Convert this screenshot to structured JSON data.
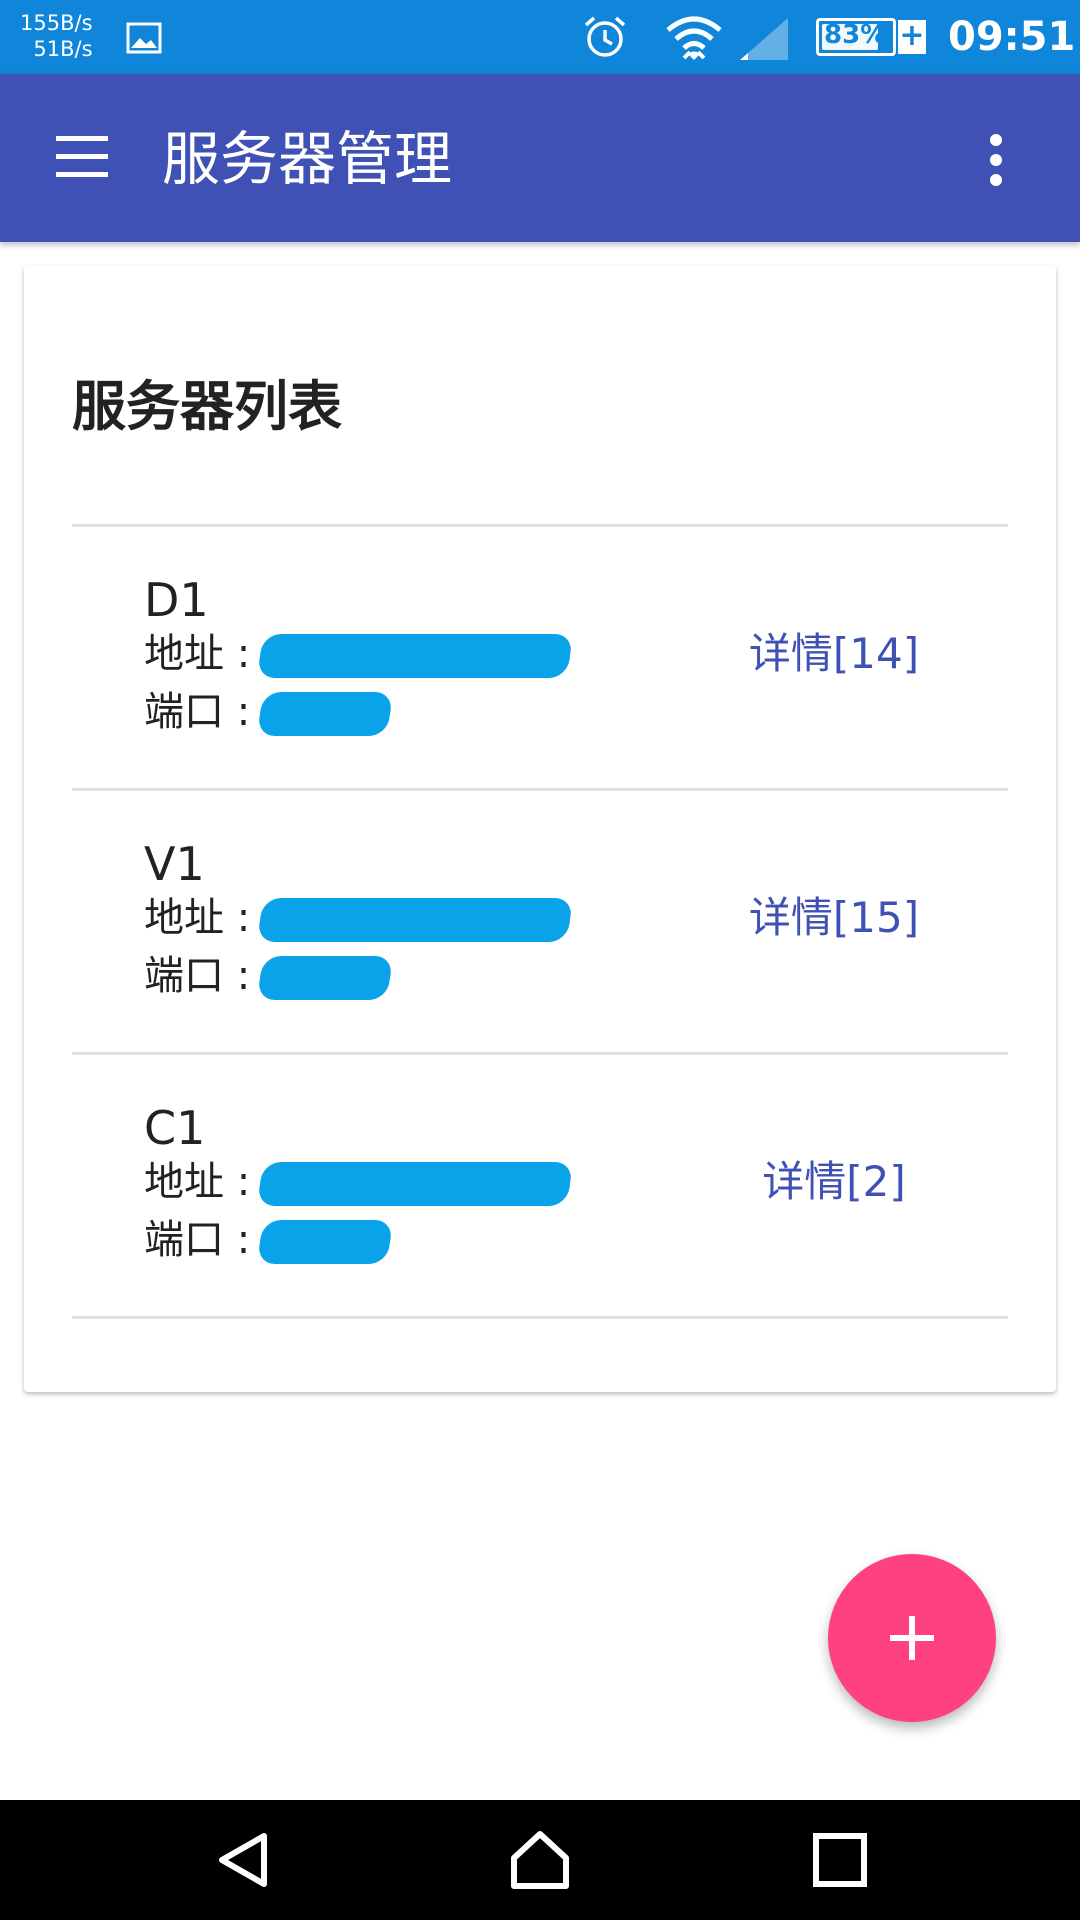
{
  "status_bar": {
    "net_speed_down": "155B/s",
    "net_speed_up": "51B/s",
    "battery_text": "83%",
    "battery_level": 0.83,
    "battery_plus": "+",
    "time": "09:51",
    "icons": [
      "gallery-icon",
      "alarm-icon",
      "wifi-icon",
      "cell-signal-icon",
      "battery-icon"
    ]
  },
  "app_bar": {
    "title": "服务器管理",
    "left_icon": "menu-icon",
    "right_icon": "more-vert-icon",
    "color": "#3f51b5"
  },
  "card": {
    "title": "服务器列表",
    "servers": [
      {
        "name": "D1",
        "address_label": "地址 :",
        "port_label": "端口 :",
        "details": "详情[14]"
      },
      {
        "name": "V1",
        "address_label": "地址 :",
        "port_label": "端口 :",
        "details": "详情[15]"
      },
      {
        "name": "C1",
        "address_label": "地址 :",
        "port_label": "端口 :",
        "details": "详情[2]"
      }
    ]
  },
  "fab": {
    "label": "+",
    "color": "#ff4081",
    "icon": "add-icon"
  },
  "nav_bar": {
    "icons": [
      "back-icon",
      "home-icon",
      "recents-icon"
    ]
  }
}
